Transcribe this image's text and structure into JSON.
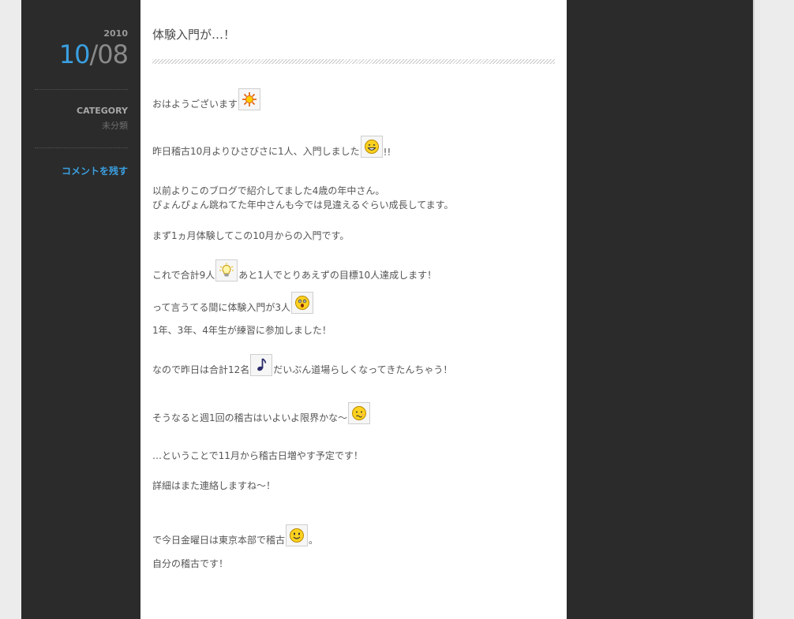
{
  "meta": {
    "year": "2010",
    "month": "10",
    "separator": "/",
    "day": "08",
    "category_label": "CATEGORY",
    "category_value": "未分類",
    "comment_link": "コメントを残す"
  },
  "post": {
    "title": "体験入門が…！",
    "lines": {
      "l1a": "おはようございます",
      "l2a": "昨日稽古10月よりひさびさに1人、入門しました",
      "l2b": "!!",
      "l3": "以前よりこのブログで紹介してました4歳の年中さん。",
      "l4": "ぴょんぴょん跳ねてた年中さんも今では見違えるぐらい成長してます。",
      "l5": "まず1ヵ月体験してこの10月からの入門です。",
      "l6a": "これで合計9人",
      "l6b": "あと1人でとりあえずの目標10人達成します！",
      "l7a": "って言うてる間に体験入門が3人",
      "l8": "1年、3年、4年生が練習に参加しました！",
      "l9a": "なので昨日は合計12名",
      "l9b": "だいぶん道場らしくなってきたんちゃう！",
      "l10a": "そうなると週1回の稽古はいよいよ限界かな～",
      "l11": "…ということで11月から稽古日増やす予定です！",
      "l12": "詳細はまた連絡しますね～！",
      "l13a": "で今日金曜日は東京本部で稽古",
      "l13b": "。",
      "l14": "自分の稽古です！"
    }
  },
  "icons": {
    "sun": "sun-icon",
    "smile_grin": "grin-face-icon",
    "bulb": "light-bulb-icon",
    "surprised": "surprised-face-icon",
    "note": "music-note-icon",
    "worried": "worried-face-icon",
    "smile": "smile-face-icon"
  },
  "colors": {
    "accent": "#3a9fe0",
    "frame": "#2b2b2b",
    "content_bg": "#ffffff"
  }
}
